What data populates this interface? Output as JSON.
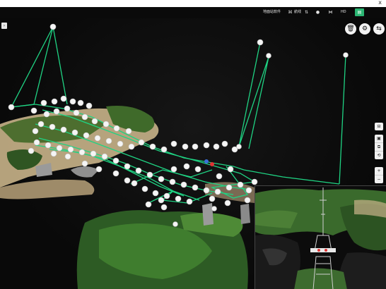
{
  "window": {
    "close_glyph": "x"
  },
  "toolbar": {
    "items": [
      {
        "label": "地面站软件",
        "icon": ""
      },
      {
        "label": "航线",
        "icon": "⌘"
      },
      {
        "label": "",
        "icon": "⇅"
      },
      {
        "label": "",
        "icon": "●"
      },
      {
        "label": "",
        "icon": "⋈"
      },
      {
        "label": "HD",
        "icon": ""
      },
      {
        "label": "",
        "icon": "▤"
      }
    ]
  },
  "top_right_buttons": [
    {
      "name": "delete-button",
      "glyph": "🗑",
      "icon": "trash-icon"
    },
    {
      "name": "settings-button",
      "glyph": "⚙",
      "icon": "gear-icon"
    },
    {
      "name": "share-button",
      "glyph": "⇆",
      "icon": "share-icon"
    }
  ],
  "side_tools": {
    "group1": [
      {
        "glyph": "⊟"
      }
    ],
    "group2": [
      {
        "glyph": "▣"
      },
      {
        "glyph": "⧉"
      },
      {
        "glyph": "⟲"
      }
    ],
    "zoom": [
      {
        "glyph": "+"
      },
      {
        "glyph": "−"
      }
    ]
  },
  "colors": {
    "route": "#1fd383",
    "waypoint": "#f5f5f5",
    "active_tab": "#2bb673"
  }
}
